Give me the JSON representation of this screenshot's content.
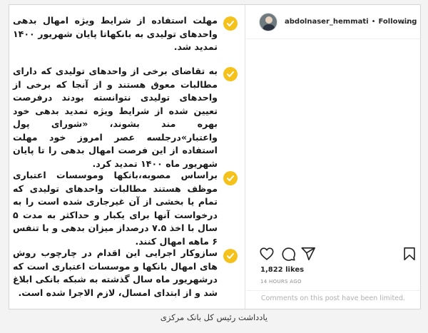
{
  "post": {
    "bullets": [
      "مهلت استفاده از شرایط ویژه امهال بدهی واحدهای تولیدی به بانکهاتا پایان شهریور ۱۴۰۰ تمدید شد.",
      "به تقاضای برخی از واحدهای تولیدی که دارای مطالبات معوق هستند و از آنجا که برخی از واحدهای تولیدی نتوانسته بودند درفرصت تعیین شده از شرایط ویژه تمدید بدهی خود بهره مند بشوند، «شورای پول واعتبار»درجلسه عصر امروز خود مهلت استفاده از این فرصت امهال بدهی را تا پایان شهریور ماه ۱۴۰۰ تمدید کرد.",
      "براساس مصوبه،بانکها وموسسات اعتباری موظف هستند مطالبات واحدهای تولیدی که تمام یا بخشی از آن غیرجاری شده است را به درخواست آنها برای یکبار و حداکثر به مدت ۵ سال با اخذ ۷.۵ درصداز میزان بدهی و با تنفس ۶ ماهه امهال کنند.",
      "سازوکار اجرایی این اقدام در چارچوب روش های امهال بانکها و موسسات اعتباری است که درشهریور ماه  سال گذشته به شبکه بانکی ابلاغ شد و از ابتدای امسال، لازم الاجرا شده است."
    ]
  },
  "header": {
    "username": "abdolnaser_hemmati",
    "separator": "•",
    "follow_status": "Following",
    "more_label": "..."
  },
  "stats": {
    "likes": "1,822 likes",
    "time": "14 HOURS AGO"
  },
  "comments": {
    "limited_notice": "Comments on this post have been limited."
  },
  "caption": "یادداشت رئیس کل بانک مرکزی",
  "colors": {
    "check_badge": "#f5c21b",
    "text": "#262626",
    "muted": "#8e8e8e"
  },
  "icons": [
    "check-icon",
    "heart-icon",
    "comment-icon",
    "share-icon",
    "bookmark-icon",
    "more-icon"
  ]
}
